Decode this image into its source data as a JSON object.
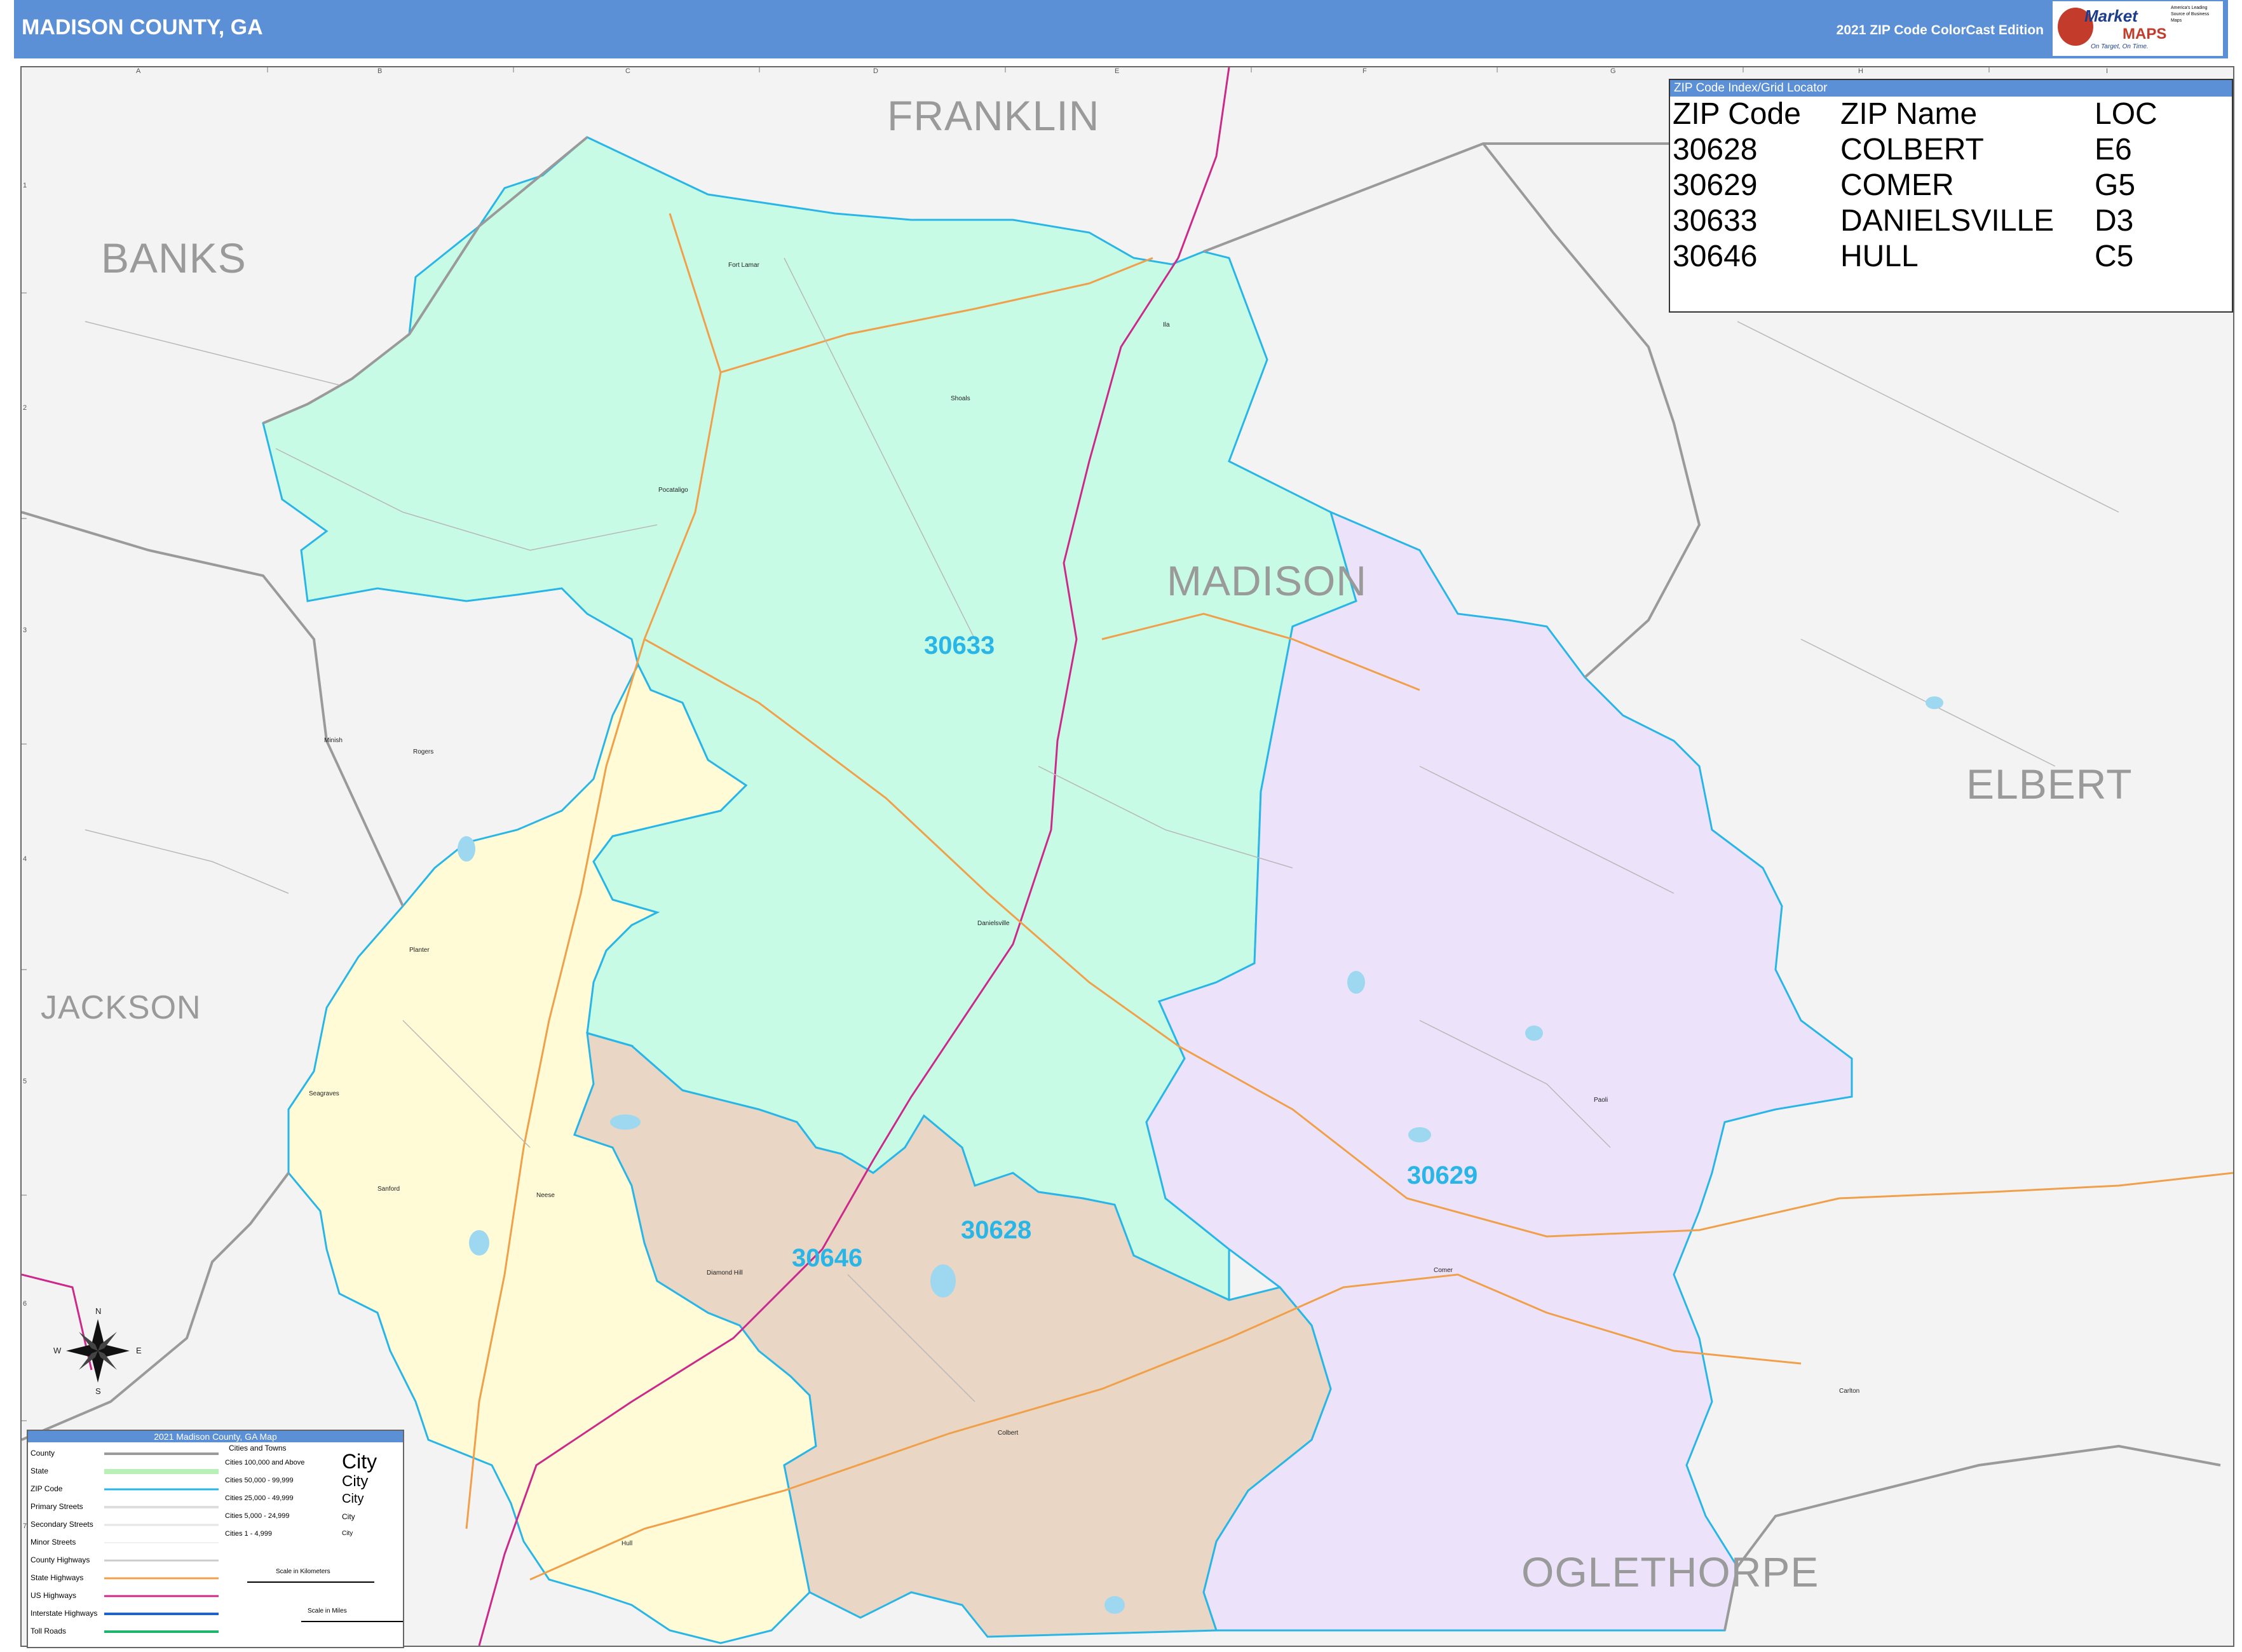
{
  "header": {
    "title": "MADISON COUNTY, GA",
    "edition": "2021 ZIP Code ColorCast Edition",
    "logo_brand_1": "Market",
    "logo_brand_2": "MAPS",
    "logo_tagline": "America's Leading Source of Business Maps",
    "logo_slogan": "On Target, On Time."
  },
  "colors": {
    "header_bg": "#5b8fd6",
    "zip_30633": "#c8fbe6",
    "zip_30629": "#ece3fb",
    "zip_30646": "#fefbd6",
    "zip_30628": "#e9d6c4",
    "zip_border": "#29b6e6",
    "outside": "#f3f3f3"
  },
  "grid": {
    "columns": [
      "A",
      "B",
      "C",
      "D",
      "E",
      "F",
      "G",
      "H",
      "I"
    ],
    "rows": [
      "1",
      "2",
      "3",
      "4",
      "5",
      "6",
      "7"
    ]
  },
  "zip_index": {
    "heading": "ZIP Code Index/Grid Locator",
    "columns": [
      "ZIP Code",
      "ZIP Name",
      "LOC"
    ],
    "rows": [
      {
        "zip": "30628",
        "name": "COLBERT",
        "loc": "E6"
      },
      {
        "zip": "30629",
        "name": "COMER",
        "loc": "G5"
      },
      {
        "zip": "30633",
        "name": "DANIELSVILLE",
        "loc": "D3"
      },
      {
        "zip": "30646",
        "name": "HULL",
        "loc": "C5"
      }
    ]
  },
  "counties": {
    "franklin": "FRANKLIN",
    "banks": "BANKS",
    "madison": "MADISON",
    "elbert": "ELBERT",
    "jackson": "JACKSON",
    "oglethorpe": "OGLETHORPE"
  },
  "zip_labels": {
    "z30633": "30633",
    "z30629": "30629",
    "z30628": "30628",
    "z30646": "30646"
  },
  "cities": {
    "fort_lamar": "Fort Lamar",
    "shoals": "Shoals",
    "pocataligo": "Pocataligo",
    "danielsville": "Danielsville",
    "planter": "Planter",
    "minish": "Minish",
    "rogers": "Rogers",
    "seagraves": "Seagraves",
    "sanford": "Sanford",
    "neese": "Neese",
    "diamond_hill": "Diamond Hill",
    "colbert": "Colbert",
    "hull": "Hull",
    "comer": "Comer",
    "paoli": "Paoli",
    "carlton": "Carlton",
    "ila": "Ila"
  },
  "compass": {
    "n": "N",
    "s": "S",
    "e": "E",
    "w": "W"
  },
  "legend": {
    "title": "2021 Madison County, GA Map",
    "items": [
      "County",
      "State",
      "ZIP Code",
      "Primary Streets",
      "Secondary Streets",
      "Minor Streets",
      "County Highways",
      "State Highways",
      "US Highways",
      "Interstate Highways",
      "Toll Roads"
    ],
    "cities_heading": "Cities and Towns",
    "city_classes": [
      "Cities 100,000 and Above",
      "Cities 50,000 - 99,999",
      "Cities 25,000 - 49,999",
      "Cities 5,000 - 24,999",
      "Cities 1 - 4,999"
    ],
    "city_samples": [
      "City",
      "City",
      "City",
      "City",
      "City"
    ],
    "scale_km": "Scale in Kilometers",
    "scale_mi": "Scale in Miles"
  }
}
